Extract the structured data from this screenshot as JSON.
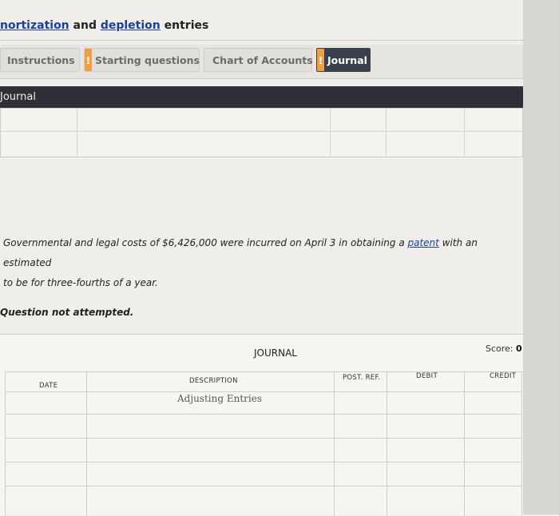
{
  "header": {
    "title_part1": "nortization",
    "title_and": " and ",
    "title_part2": "depletion",
    "title_rest": " entries"
  },
  "tabs": [
    {
      "label": "Instructions",
      "warn": ""
    },
    {
      "label": "Starting questions",
      "warn": "!"
    },
    {
      "label": "Chart of Accounts",
      "warn": ""
    },
    {
      "label": "Journal",
      "warn": "!"
    }
  ],
  "section": {
    "title": "Journal"
  },
  "question": {
    "text_before": "Governmental and legal costs of $6,426,000 were incurred on April 3 in obtaining a ",
    "link": "patent",
    "text_after": " with an estimated",
    "line2": "to be for three-fourths of a year."
  },
  "status": "Question not attempted.",
  "journal": {
    "title": "JOURNAL",
    "score_label": "Score: ",
    "score_value": "0",
    "columns": {
      "date": "DATE",
      "description": "DESCRIPTION",
      "post_ref": "POST. REF.",
      "debit": "DEBIT",
      "credit": "CREDIT"
    },
    "first_row_hint": "Adjusting Entries"
  }
}
